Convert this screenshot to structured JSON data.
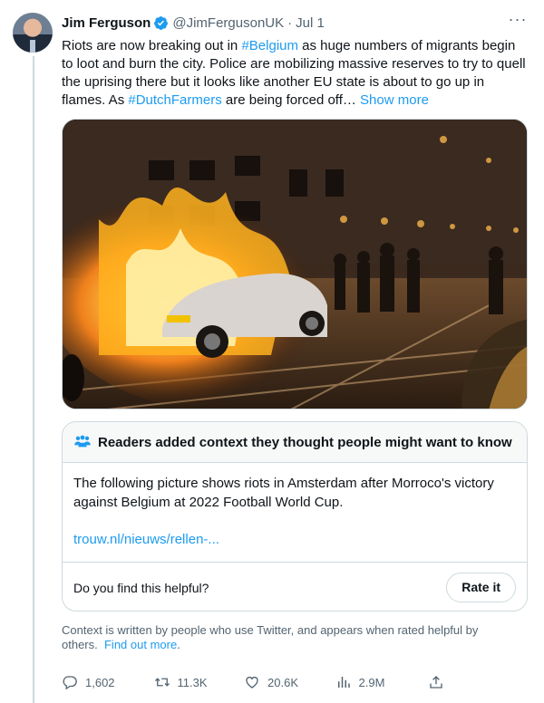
{
  "tweet": {
    "author_name": "Jim Ferguson",
    "handle": "@JimFergusonUK",
    "separator": "·",
    "date": "Jul 1",
    "text_1": "Riots are now breaking out in ",
    "hashtag_1": "#Belgium",
    "text_2": " as huge numbers of migrants begin to loot and burn the city. Police are mobilizing massive reserves to try to quell the uprising there but it looks like another EU state is about to go up in flames. As ",
    "hashtag_2": "#DutchFarmers",
    "text_3": " are being forced off… ",
    "show_more": "Show more",
    "media_alt": "Burning car on a city street at night with people nearby"
  },
  "note": {
    "header": "Readers added context they thought people might want to know",
    "body": "The following picture shows riots in Amsterdam after Morroco's victory against Belgium at 2022 Football World Cup.",
    "link": "trouw.nl/nieuws/rellen-...",
    "helpful_question": "Do you find this helpful?",
    "rate_button": "Rate it"
  },
  "context": {
    "text": "Context is written by people who use Twitter, and appears when rated helpful by others.",
    "link": "Find out more",
    "period": "."
  },
  "actions": {
    "replies": "1,602",
    "retweets": "11.3K",
    "likes": "20.6K",
    "views": "2.9M"
  },
  "colors": {
    "accent": "#1d9bf0",
    "text": "#0f1419",
    "muted": "#536471",
    "border": "#cfd9de"
  },
  "icons": [
    "verified-badge-icon",
    "more-icon",
    "people-icon",
    "reply-icon",
    "retweet-icon",
    "like-icon",
    "views-icon",
    "share-icon"
  ]
}
